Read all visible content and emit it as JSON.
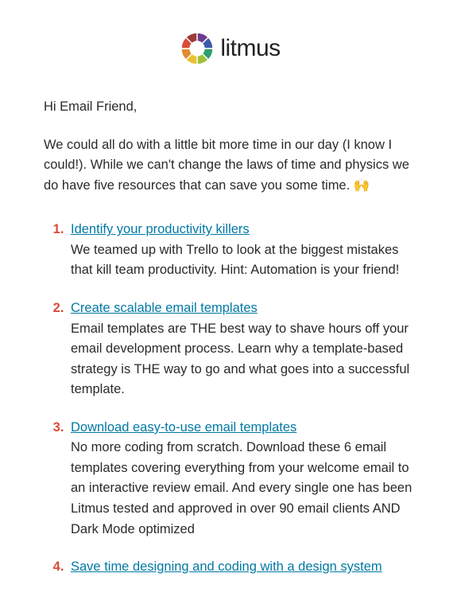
{
  "brand": "litmus",
  "logo_colors": [
    "#6d3b8f",
    "#3b5ca9",
    "#2e9e6e",
    "#9ec23c",
    "#e8c231",
    "#e28b2d",
    "#d94c3a",
    "#9e3a3a"
  ],
  "greeting": "Hi Email Friend,",
  "intro": "We could all do with a little bit more time in our day (I know I could!). While we can't change the laws of time and physics we do have five resources that can save you some time. 🙌",
  "items": [
    {
      "title": "Identify your productivity killers",
      "body": "We teamed up with Trello to look at the biggest mistakes that kill team productivity. Hint: Automation is your friend!"
    },
    {
      "title": "Create scalable email templates",
      "body": "Email templates are THE best way to shave hours off your email development process. Learn why a template-based strategy is THE way to go and what goes into a successful template."
    },
    {
      "title": "Download easy-to-use email templates",
      "body": "No more coding from scratch. Download these 6 email templates covering everything from your welcome email to an interactive review email. And every single one has been Litmus tested and approved in over 90 email clients AND Dark Mode optimized"
    },
    {
      "title": "Save time designing and coding with a design system",
      "body": ""
    }
  ]
}
